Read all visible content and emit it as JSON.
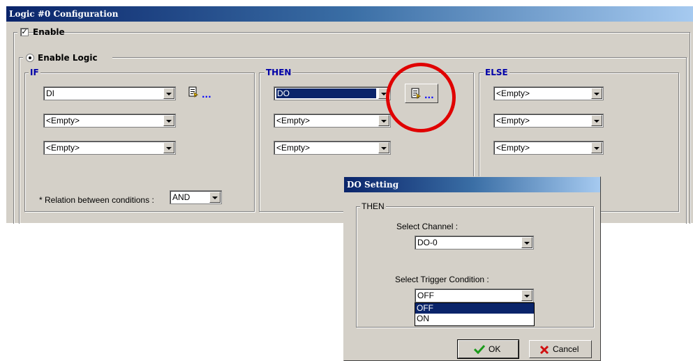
{
  "main_window": {
    "title": "Logic #0 Configuration",
    "enable_label": "Enable",
    "enable_checked": true,
    "enable_logic_label": "Enable Logic"
  },
  "if_group": {
    "legend": "IF",
    "conditions": [
      "DI",
      "<Empty>",
      "<Empty>"
    ],
    "relation_label": "* Relation between conditions :",
    "relation_value": "AND",
    "setting_dots": "..."
  },
  "then_group": {
    "legend": "THEN",
    "actions": [
      "DO",
      "<Empty>",
      "<Empty>"
    ],
    "setting_dots": "..."
  },
  "else_group": {
    "legend": "ELSE",
    "actions": [
      "<Empty>",
      "<Empty>",
      "<Empty>"
    ]
  },
  "do_dialog": {
    "title": "DO Setting",
    "group_legend": "THEN",
    "channel_label": "Select Channel :",
    "channel_value": "DO-0",
    "trigger_label": "Select Trigger Condition :",
    "trigger_value": "OFF",
    "trigger_options": [
      "OFF",
      "ON"
    ],
    "ok_label": "OK",
    "cancel_label": "Cancel"
  },
  "colors": {
    "highlight_circle": "#e00000",
    "selection": "#0a246a",
    "legend_blue": "#0000a8"
  }
}
